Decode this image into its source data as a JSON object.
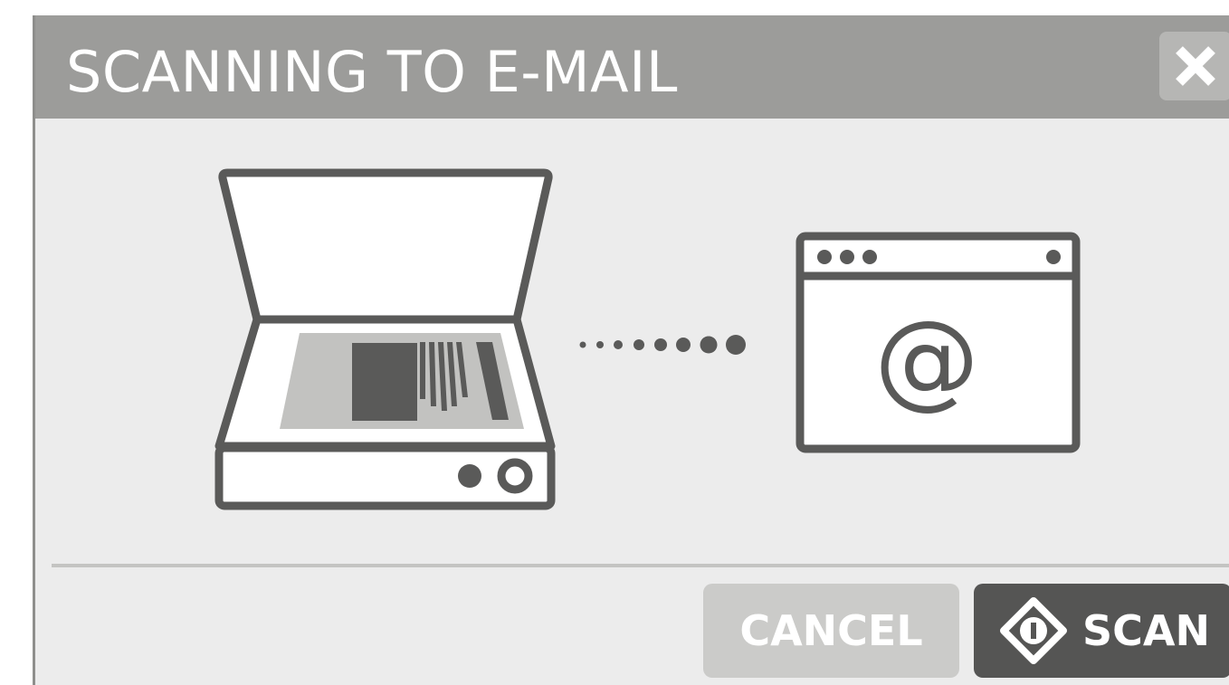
{
  "dialog": {
    "title": "SCANNING TO E-MAIL",
    "close_icon": "close-x-icon"
  },
  "illustration": {
    "source_icon": "flatbed-scanner-icon",
    "connector_icon": "dotted-progress-dots",
    "destination_icon": "browser-window-email-icon",
    "email_symbol": "@"
  },
  "footer": {
    "cancel_label": "CANCEL",
    "scan_label": "SCAN",
    "scan_icon": "start-diamond-icon"
  },
  "colors": {
    "titlebar": "#9c9c9a",
    "body": "#ececec",
    "icon_stroke": "#5a5a59",
    "cancel_button": "#cbcbc9",
    "scan_button": "#555554"
  }
}
